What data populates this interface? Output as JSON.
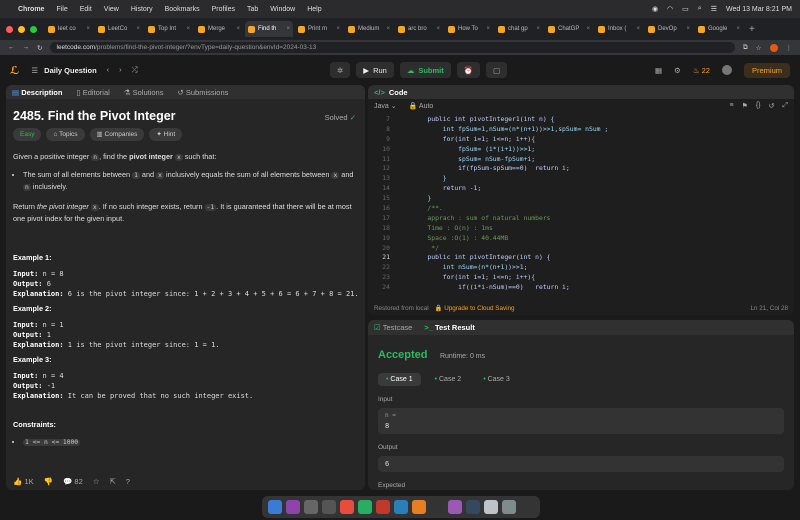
{
  "menubar": {
    "items": [
      "Chrome",
      "File",
      "Edit",
      "View",
      "History",
      "Bookmarks",
      "Profiles",
      "Tab",
      "Window",
      "Help"
    ],
    "datetime": "Wed 13 Mar  8:21 PM"
  },
  "tabs": [
    "leet co",
    "LeetCo",
    "Top Int",
    "Merge",
    "Find th",
    "Print m",
    "Medium",
    "arc bro",
    "How To",
    "chat gp",
    "ChatGP",
    "Inbox (",
    "DevOp",
    "Google"
  ],
  "active_tab_index": 4,
  "address": {
    "host": "leetcode.com",
    "path": "/problems/find-the-pivot-integer/?envType=daily-question&envId=2024-03-13"
  },
  "lc_nav": {
    "daily": "Daily Question",
    "run": "Run",
    "submit": "Submit",
    "streak": "22",
    "premium": "Premium"
  },
  "left_tabs": [
    "Description",
    "Editorial",
    "Solutions",
    "Submissions"
  ],
  "problem": {
    "title": "2485. Find the Pivot Integer",
    "solved": "Solved",
    "chips": [
      "Easy",
      "Topics",
      "Companies",
      "Hint"
    ],
    "intro_a": "Given a positive integer ",
    "intro_n": "n",
    "intro_b": ", find the ",
    "intro_bold": "pivot integer",
    "intro_x": "x",
    "intro_c": " such that:",
    "bullet_a": "The sum of all elements between ",
    "bullet_1": "1",
    "bullet_and": " and ",
    "bullet_x": "x",
    "bullet_b": " inclusively equals the sum of all elements between ",
    "bullet_x2": "x",
    "bullet_and2": " and ",
    "bullet_n": "n",
    "bullet_c": " inclusively.",
    "ret_a": "Return ",
    "ret_em": "the pivot integer ",
    "ret_x": "x",
    "ret_b": ". If no such integer exists, return ",
    "ret_m1": "-1",
    "ret_c": ". It is guaranteed that there will be at most one pivot index for the given input.",
    "examples": [
      {
        "h": "Example 1:",
        "input": "n = 8",
        "output": "6",
        "explanation": "6 is the pivot integer since: 1 + 2 + 3 + 4 + 5 + 6 = 6 + 7 + 8 = 21."
      },
      {
        "h": "Example 2:",
        "input": "n = 1",
        "output": "1",
        "explanation": "1 is the pivot integer since: 1 = 1."
      },
      {
        "h": "Example 3:",
        "input": "n = 4",
        "output": "-1",
        "explanation": "It can be proved that no such integer exist."
      }
    ],
    "input_lbl": "Input: ",
    "output_lbl": "Output: ",
    "expl_lbl": "Explanation: ",
    "constraints_h": "Constraints:",
    "constraint": "1 <= n <= 1000",
    "likes": "1K",
    "comments": "82"
  },
  "code": {
    "header": "Code",
    "lang": "Java",
    "auto": "Auto",
    "lines": [
      {
        "n": "7",
        "t": "    public int pivotInteger1(int n) {",
        "c": "kw"
      },
      {
        "n": "8",
        "t": "        int fpSum=1,nSum=(n*(n+1))>>1,spSum= nSum ;",
        "c": ""
      },
      {
        "n": "9",
        "t": "        for(int i=1; i<=n; i++){",
        "c": "kw"
      },
      {
        "n": "10",
        "t": "            fpSum= (i*(i+1))>>1;",
        "c": ""
      },
      {
        "n": "11",
        "t": "            spSum= nSum-fpSum+i;",
        "c": ""
      },
      {
        "n": "12",
        "t": "            if(fpSum-spSum==0)  return i;",
        "c": "kw"
      },
      {
        "n": "13",
        "t": "        }",
        "c": ""
      },
      {
        "n": "14",
        "t": "        return -1;",
        "c": "kw"
      },
      {
        "n": "15",
        "t": "    }",
        "c": ""
      },
      {
        "n": "16",
        "t": "    /**.",
        "c": "cm"
      },
      {
        "n": "17",
        "t": "    apprach : sum of natural numbers",
        "c": "cm"
      },
      {
        "n": "18",
        "t": "    Time : O(n) : 1ms",
        "c": "cm"
      },
      {
        "n": "19",
        "t": "    Space :O(1) : 40.44MB",
        "c": "cm"
      },
      {
        "n": "20",
        "t": "     */",
        "c": "cm"
      },
      {
        "n": "21",
        "t": "    public int pivotInteger(int n) {",
        "c": "kw"
      },
      {
        "n": "22",
        "t": "        int nSum=(n*(n+1))>>1;",
        "c": ""
      },
      {
        "n": "23",
        "t": "        for(int i=1; i<=n; i++){",
        "c": "kw"
      },
      {
        "n": "24",
        "t": "            if((i*i-nSum)==0)   return i;",
        "c": "kw"
      }
    ],
    "current_line": "21",
    "restored": "Restored from local",
    "upgrade": "Upgrade to Cloud Saving",
    "cursor": "Ln 21, Col 28"
  },
  "test": {
    "tabs": [
      "Testcase",
      "Test Result"
    ],
    "status": "Accepted",
    "runtime": "Runtime: 0 ms",
    "cases": [
      "Case 1",
      "Case 2",
      "Case 3"
    ],
    "input_label": "Input",
    "var_name": "n =",
    "var_value": "8",
    "output_label": "Output",
    "output_value": "6",
    "expected_label": "Expected"
  },
  "colors": {
    "accent": "#ffa116",
    "accepted": "#2cbb5d"
  }
}
